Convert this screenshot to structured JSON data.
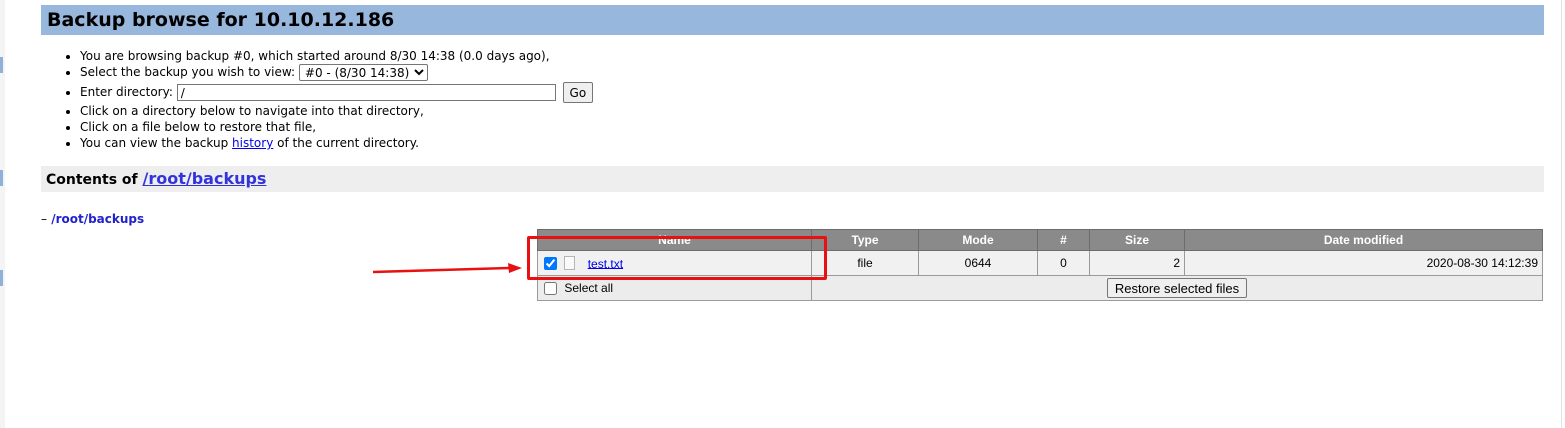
{
  "window": {
    "title": "Backup browse for 10.10.12.186"
  },
  "info": {
    "browsing_text": "You are browsing backup #0, which started around 8/30 14:38 (0.0 days ago),",
    "select_label": "Select the backup you wish to view:",
    "select_value": "#0 - (8/30 14:38)",
    "dir_label": "Enter directory:",
    "dir_value": "/",
    "go_label": "Go",
    "click_dir_text": "Click on a directory below to navigate into that directory,",
    "click_file_text": "Click on a file below to restore that file,",
    "history_prefix": "You can view the backup",
    "history_link": "history",
    "history_suffix": "of the current directory."
  },
  "contents": {
    "label": "Contents of",
    "path": "/root/backups"
  },
  "tree": {
    "dash": "–",
    "item": "/root/backups"
  },
  "table": {
    "headers": {
      "name": "Name",
      "type": "Type",
      "mode": "Mode",
      "num": "#",
      "size": "Size",
      "date": "Date modified"
    },
    "rows": [
      {
        "checked": true,
        "name": "test.txt",
        "type": "file",
        "mode": "0644",
        "num": "0",
        "size": "2",
        "date": "2020-08-30 14:12:39"
      }
    ],
    "select_all_label": "Select all",
    "restore_label": "Restore selected files"
  },
  "annotation": {
    "color": "#e81010",
    "shape": "rectangle-and-arrow"
  }
}
